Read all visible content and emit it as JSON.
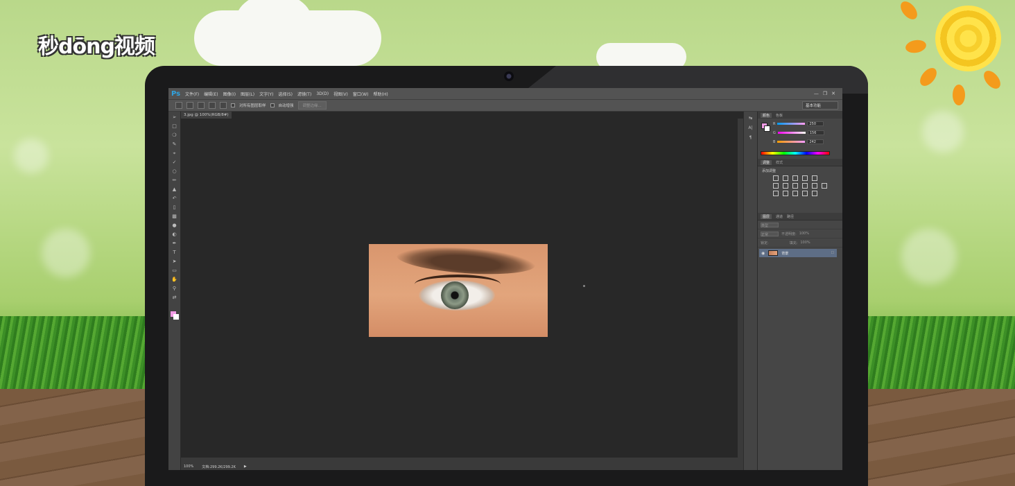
{
  "brand": {
    "logo_text": "秒dōng视频"
  },
  "photoshop": {
    "app_logo": "Ps",
    "menu": [
      "文件(F)",
      "编辑(E)",
      "图像(I)",
      "图层(L)",
      "文字(Y)",
      "选择(S)",
      "滤镜(T)",
      "3D(D)",
      "视图(V)",
      "窗口(W)",
      "帮助(H)"
    ],
    "window_controls": [
      "minimize-icon",
      "restore-icon",
      "close-icon"
    ],
    "options_bar": {
      "sample_all_layers": "对所有图层取样",
      "auto_enhance": "自动增强",
      "refine_edge_button": "调整边缘...",
      "workspace": "基本功能"
    },
    "document_tab": "3.jpg @ 100%(RGB/8#)",
    "status_bar": {
      "zoom": "100%",
      "doc_size": "文档:299.2K/299.2K"
    },
    "panels": {
      "color_tabs": [
        "颜色",
        "色板"
      ],
      "color_values": {
        "R": "250",
        "G": "156",
        "B": "242"
      },
      "adjust_tabs": [
        "调整",
        "样式"
      ],
      "adjust_title": "添加调整",
      "layers_tabs": [
        "图层",
        "通道",
        "路径"
      ],
      "layers_filter": "类型",
      "blend_mode": "正常",
      "opacity_label": "不透明度:",
      "opacity_value": "100%",
      "lock_label": "锁定:",
      "fill_label": "填充:",
      "fill_value": "100%",
      "layer_name": "背景"
    },
    "colors": {
      "foreground": "#f29ce6",
      "background": "#ffffff",
      "ui_bg": "#535353"
    }
  }
}
